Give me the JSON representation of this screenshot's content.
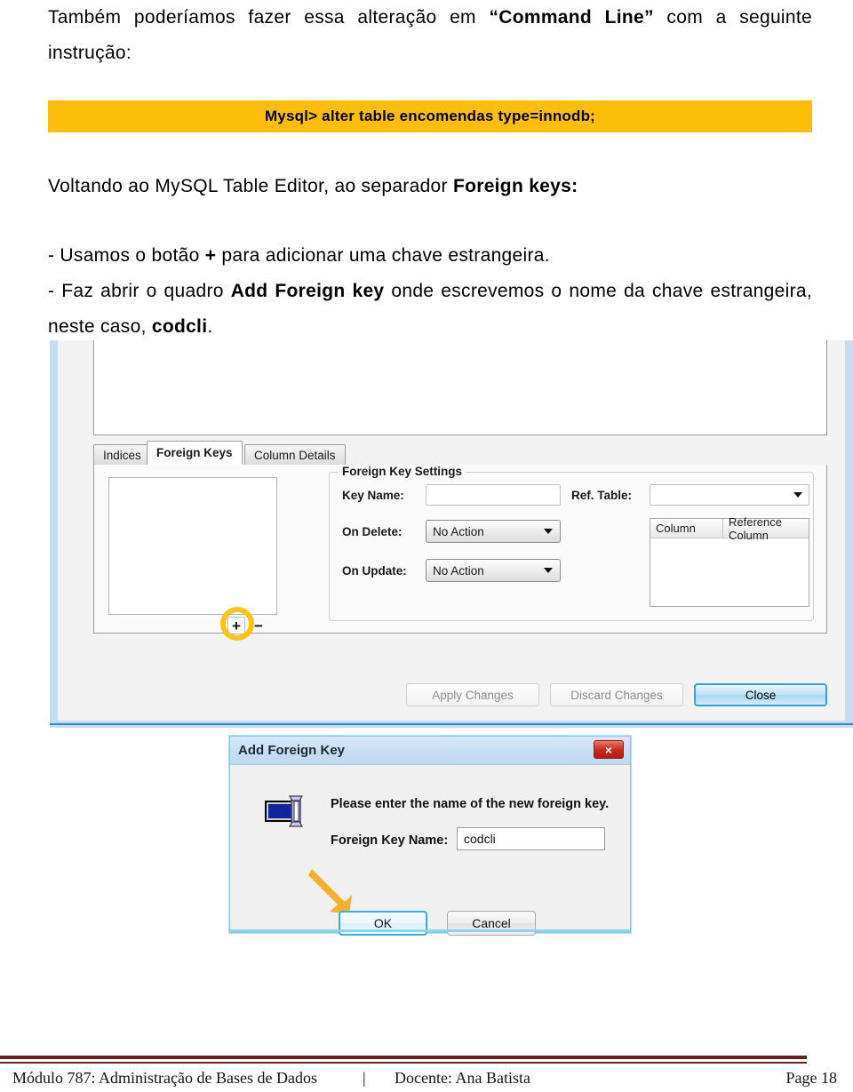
{
  "document": {
    "paragraph_1_pre": "Também poderíamos fazer essa alteração em ",
    "paragraph_1_bold": "“Command Line”",
    "paragraph_1_post": " com a seguinte instrução:",
    "code_banner": "Mysql> alter table encomendas type=innodb;",
    "paragraph_2_pre": "Voltando ao MySQL Table Editor, ao separador ",
    "paragraph_2_bold": "Foreign keys:",
    "bullet_1_pre": "- Usamos o botão ",
    "bullet_1_bold": "+",
    "bullet_1_post": " para adicionar uma chave estrangeira.",
    "bullet_2_pre": "- Faz abrir o quadro ",
    "bullet_2_bold": "Add Foreign key",
    "bullet_2_mid": " onde escrevemos o nome da chave estrangeira, neste caso, ",
    "bullet_2_bold2": "codcli",
    "bullet_2_post": "."
  },
  "table_editor": {
    "tabs": [
      {
        "label": "Indices",
        "active": false
      },
      {
        "label": "Foreign Keys",
        "active": true
      },
      {
        "label": "Column Details",
        "active": false
      }
    ],
    "add_button": "+",
    "remove_button": "−",
    "fieldset_legend": "Foreign Key Settings",
    "labels": {
      "key_name": "Key Name:",
      "on_delete": "On Delete:",
      "on_update": "On Update:",
      "ref_table": "Ref. Table:"
    },
    "values": {
      "key_name": "",
      "on_delete": "No Action",
      "on_update": "No Action",
      "ref_table": ""
    },
    "ref_columns_table": {
      "headers": [
        "Column",
        "Reference Column"
      ],
      "rows": []
    },
    "buttons": {
      "apply": "Apply Changes",
      "discard": "Discard Changes",
      "close": "Close"
    },
    "highlight_color": "#fcc310"
  },
  "add_foreign_key_dialog": {
    "title": "Add Foreign Key",
    "close_label": "×",
    "message": "Please enter the name of the new foreign key.",
    "field_label": "Foreign Key Name:",
    "field_value": "codcli",
    "field_placeholder": "",
    "ok_label": "OK",
    "cancel_label": "Cancel",
    "arrow_color": "#f2b12a"
  },
  "footer": {
    "module": "Módulo 787: Administração de Bases de Dados",
    "separator": "|",
    "teacher": "Docente: Ana Batista",
    "page": "Page 18",
    "rule_color": "#6b2020"
  }
}
